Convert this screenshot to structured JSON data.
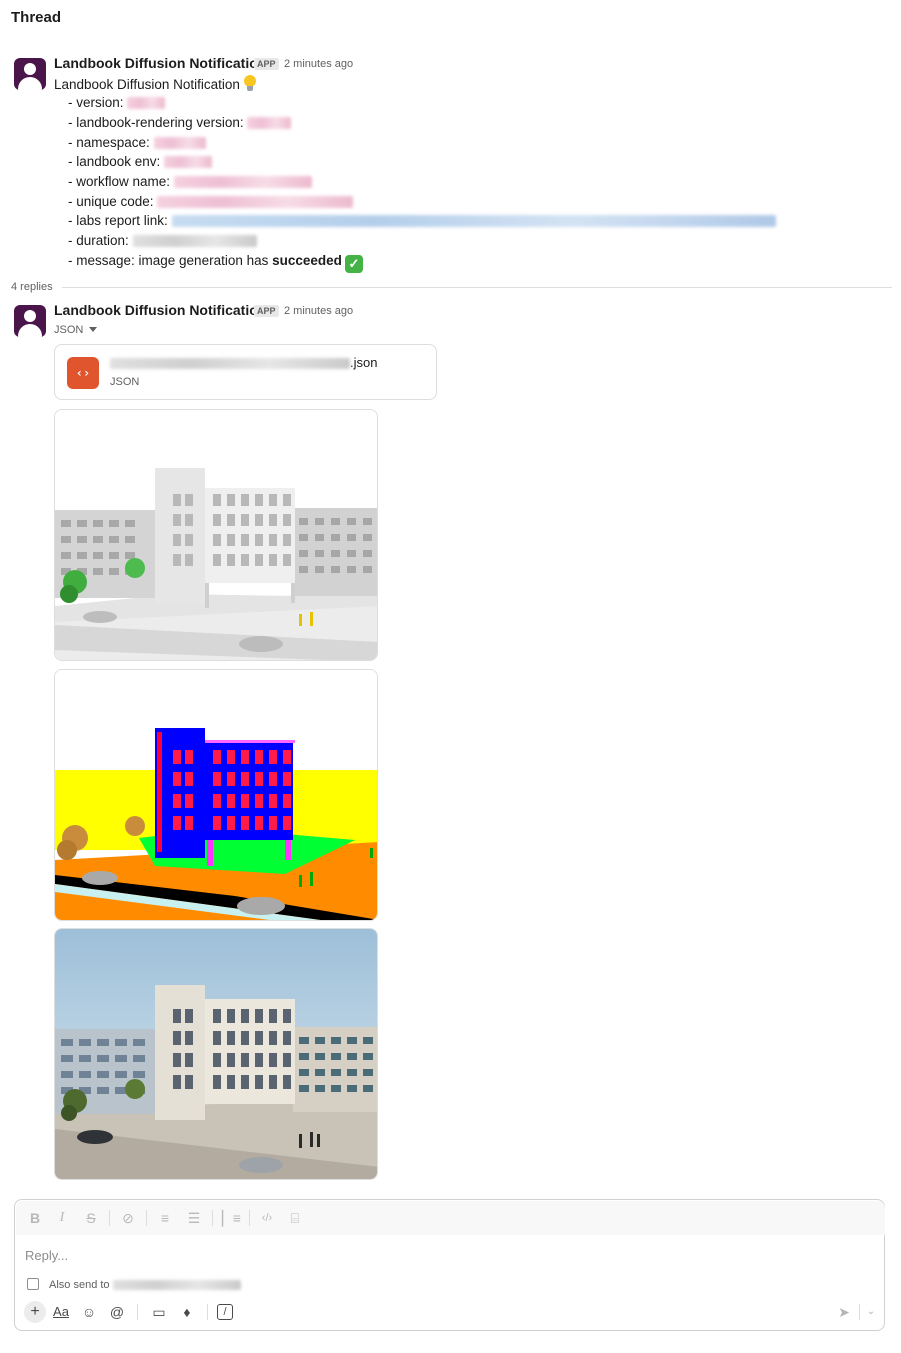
{
  "header": {
    "title": "Thread"
  },
  "parent": {
    "sender": "Landbook Diffusion Notification",
    "badge": "APP",
    "time": "2 minutes ago",
    "intro": "Landbook Diffusion Notification",
    "fields": {
      "version": "- version:",
      "rendering_version": "- landbook-rendering version:",
      "namespace": "- namespace:",
      "env": "- landbook env:",
      "workflow": "- workflow name:",
      "unique_code": "- unique code:",
      "labs_link": "- labs report link:",
      "duration": "- duration:",
      "message_prefix": "- message: image generation has",
      "message_status": "succeeded"
    }
  },
  "replies": {
    "count_label": "4 replies"
  },
  "reply": {
    "sender": "Landbook Diffusion Notification",
    "badge": "APP",
    "time": "2 minutes ago",
    "toggle_label": "JSON",
    "file": {
      "name_suffix": ".json",
      "type": "JSON",
      "icon": "code-icon"
    }
  },
  "composer": {
    "placeholder": "Reply...",
    "also_send_label": "Also send to",
    "format_buttons": [
      "B",
      "I",
      "S",
      "link",
      "ordered-list",
      "bullet-list",
      "blockquote",
      "code",
      "code-block"
    ],
    "toolbar": [
      "plus",
      "Aa",
      "emoji",
      "mention",
      "video",
      "microphone",
      "slash-command",
      "send"
    ]
  },
  "colors": {
    "accent_app": "#4a154b",
    "file_icon": "#e0542e",
    "success": "#44b244"
  }
}
